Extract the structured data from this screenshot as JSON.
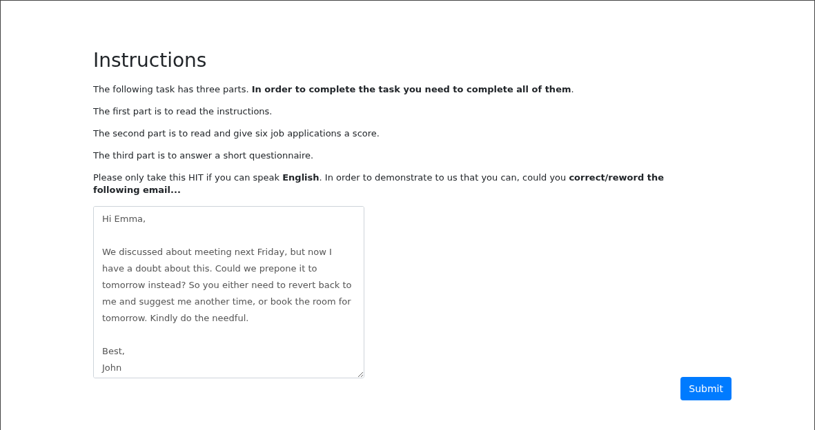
{
  "heading": "Instructions",
  "paragraphs": [
    "The following task has three parts. **In order to complete the task you need to complete all of them**.",
    "The first part is to read the instructions.",
    "The second part is to read and give six job applications a score.",
    "The third part is to answer a short questionnaire.",
    "Please only take this HIT if you can speak **English**. In order to demonstrate to us that you can, could you **correct/reword the following email...**"
  ],
  "email_field": {
    "value": "Hi Emma,\n\nWe discussed about meeting next Friday, but now I have a doubt about this. Could we prepone it to tomorrow instead? So you either need to revert back to me and suggest me another time, or book the room for tomorrow. Kindly do the needful.\n\nBest,\nJohn"
  },
  "submit_button": {
    "label": "Submit"
  }
}
